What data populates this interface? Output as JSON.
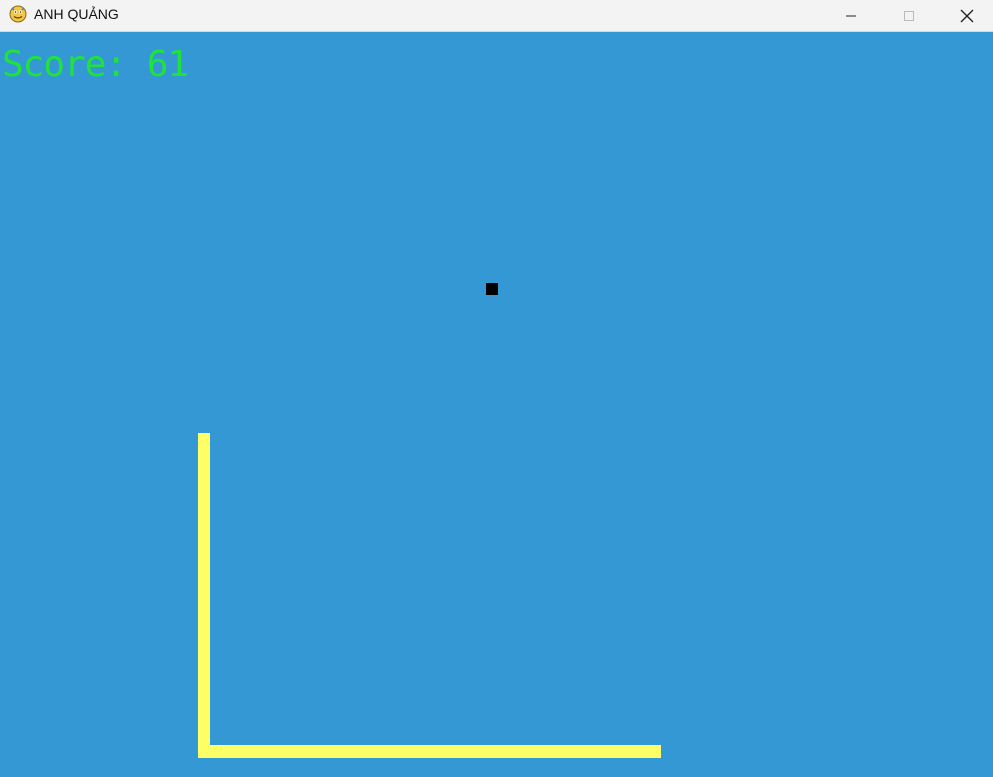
{
  "window": {
    "title": "ANH QUẢNG",
    "icon": "python-snake-icon",
    "controls": {
      "minimize_icon": "minimize-icon",
      "maximize_icon": "maximize-icon",
      "close_icon": "close-icon"
    }
  },
  "game": {
    "score_text": "Score: 61",
    "colors": {
      "background": "#3498d4",
      "score": "#1fe33b",
      "snake": "#ffff66",
      "food": "#000000"
    }
  }
}
